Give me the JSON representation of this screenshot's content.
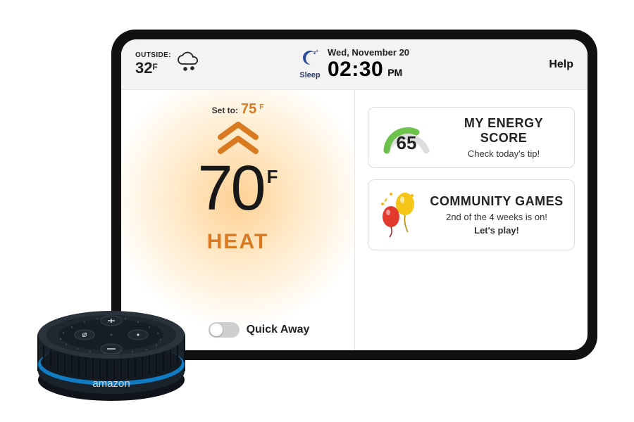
{
  "topbar": {
    "outside_label": "OUTSIDE:",
    "outside_temp": "32",
    "outside_unit": "F",
    "weather_icon": "snow-cloud-icon",
    "sleep_label": "Sleep",
    "date": "Wed, November 20",
    "time": "02:30",
    "ampm": "PM",
    "help_label": "Help"
  },
  "thermostat": {
    "set_to_label": "Set to:",
    "set_to_value": "75",
    "set_to_unit": "F",
    "current_temp": "70",
    "current_unit": "F",
    "mode": "HEAT",
    "quick_away_label": "Quick Away",
    "quick_away_on": false
  },
  "cards": {
    "energy": {
      "score": "65",
      "title": "MY ENERGY SCORE",
      "sub": "Check today's tip!"
    },
    "community": {
      "title": "COMMUNITY GAMES",
      "sub_line1": "2nd of the 4 weeks is on!",
      "sub_line2": "Let's play!"
    }
  },
  "device": {
    "brand": "amazon"
  },
  "colors": {
    "accent_heat": "#d97a20",
    "gauge_green": "#6cc24a"
  }
}
